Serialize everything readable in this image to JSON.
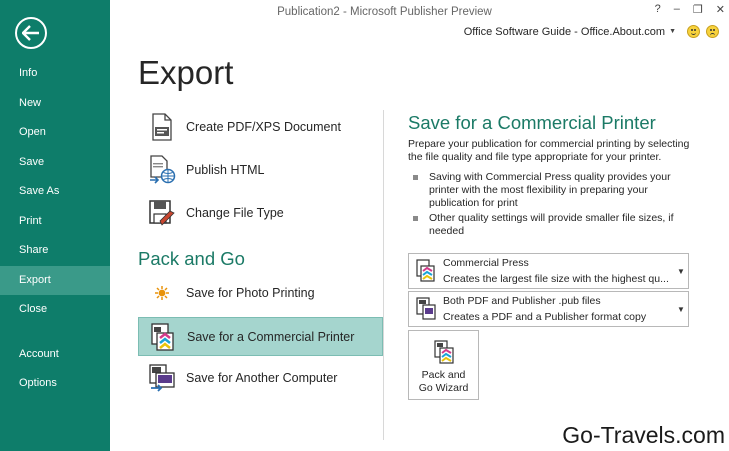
{
  "window": {
    "title": "Publication2 - Microsoft Publisher Preview",
    "controls": [
      "?",
      "–",
      "❐",
      "✕"
    ],
    "account_name": "Office Software Guide - Office.About.com"
  },
  "sidebar": {
    "items": [
      {
        "label": "Info"
      },
      {
        "label": "New"
      },
      {
        "label": "Open"
      },
      {
        "label": "Save"
      },
      {
        "label": "Save As"
      },
      {
        "label": "Print"
      },
      {
        "label": "Share"
      },
      {
        "label": "Export",
        "active": true
      },
      {
        "label": "Close"
      }
    ],
    "bottom_items": [
      {
        "label": "Account"
      },
      {
        "label": "Options"
      }
    ]
  },
  "page": {
    "title": "Export"
  },
  "export_options": [
    {
      "label": "Create PDF/XPS Document",
      "icon": "pdf-document-icon"
    },
    {
      "label": "Publish HTML",
      "icon": "publish-html-icon"
    },
    {
      "label": "Change File Type",
      "icon": "change-file-type-icon"
    }
  ],
  "pack_and_go": {
    "heading": "Pack and Go",
    "options": [
      {
        "label": "Save for Photo Printing",
        "icon": "photo-printing-icon"
      },
      {
        "label": "Save for a Commercial Printer",
        "icon": "commercial-printer-icon",
        "selected": true
      },
      {
        "label": "Save for Another Computer",
        "icon": "another-computer-icon"
      }
    ]
  },
  "right_panel": {
    "title": "Save for a Commercial Printer",
    "description": "Prepare your publication for commercial printing by selecting the file quality and file type appropriate for your printer.",
    "bullets": [
      "Saving with Commercial Press quality provides your printer with the most flexibility in preparing your publication for print",
      "Other quality settings will provide smaller file sizes, if needed"
    ],
    "quality_dropdown": {
      "selected": "Commercial Press",
      "description": "Creates the largest file size with the highest qu..."
    },
    "format_dropdown": {
      "selected": "Both PDF and Publisher .pub files",
      "description": "Creates a PDF and a Publisher format copy"
    },
    "pack_button": {
      "line1": "Pack and",
      "line2": "Go Wizard"
    }
  },
  "watermark": "Go-Travels.com",
  "colors": {
    "sidebar": "#0e7d6a",
    "sidebar_active": "#3a9a89",
    "accent_heading": "#1b7a66",
    "selected_option": "#a5d5ce"
  }
}
